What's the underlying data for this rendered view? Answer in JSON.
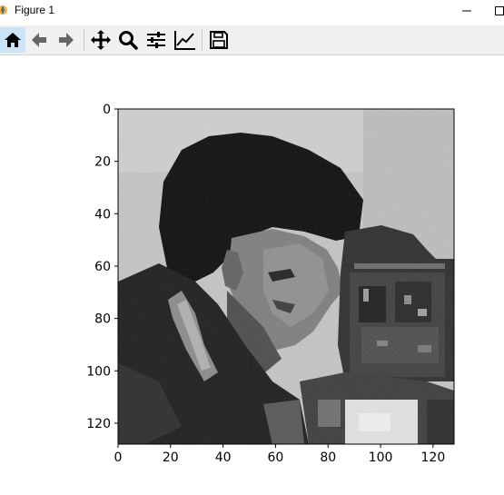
{
  "window": {
    "title": "Figure 1"
  },
  "toolbar": {
    "buttons": [
      {
        "name": "home",
        "icon": "home-icon",
        "active": true
      },
      {
        "name": "back",
        "icon": "arrow-left-icon"
      },
      {
        "name": "forward",
        "icon": "arrow-right-icon"
      },
      {
        "name": "pan",
        "icon": "move-icon"
      },
      {
        "name": "zoom",
        "icon": "zoom-icon"
      },
      {
        "name": "configure-subplots",
        "icon": "sliders-icon"
      },
      {
        "name": "edit-axes",
        "icon": "line-chart-icon"
      },
      {
        "name": "save",
        "icon": "save-icon"
      }
    ]
  },
  "colors": {
    "toolbar_bg": "#f0f0f0",
    "active_button": "#cce4f7"
  },
  "chart_data": {
    "type": "heatmap",
    "colormap": "gray",
    "image_size": [
      128,
      128
    ],
    "xlim": [
      0,
      128
    ],
    "ylim": [
      128,
      0
    ],
    "xticks": [
      0,
      20,
      40,
      60,
      80,
      100,
      120
    ],
    "yticks": [
      0,
      20,
      40,
      60,
      80,
      100,
      120
    ],
    "xtick_labels": [
      "0",
      "20",
      "40",
      "60",
      "80",
      "100",
      "120"
    ],
    "ytick_labels": [
      "0",
      "20",
      "40",
      "60",
      "80",
      "100",
      "120"
    ],
    "grid": false
  }
}
